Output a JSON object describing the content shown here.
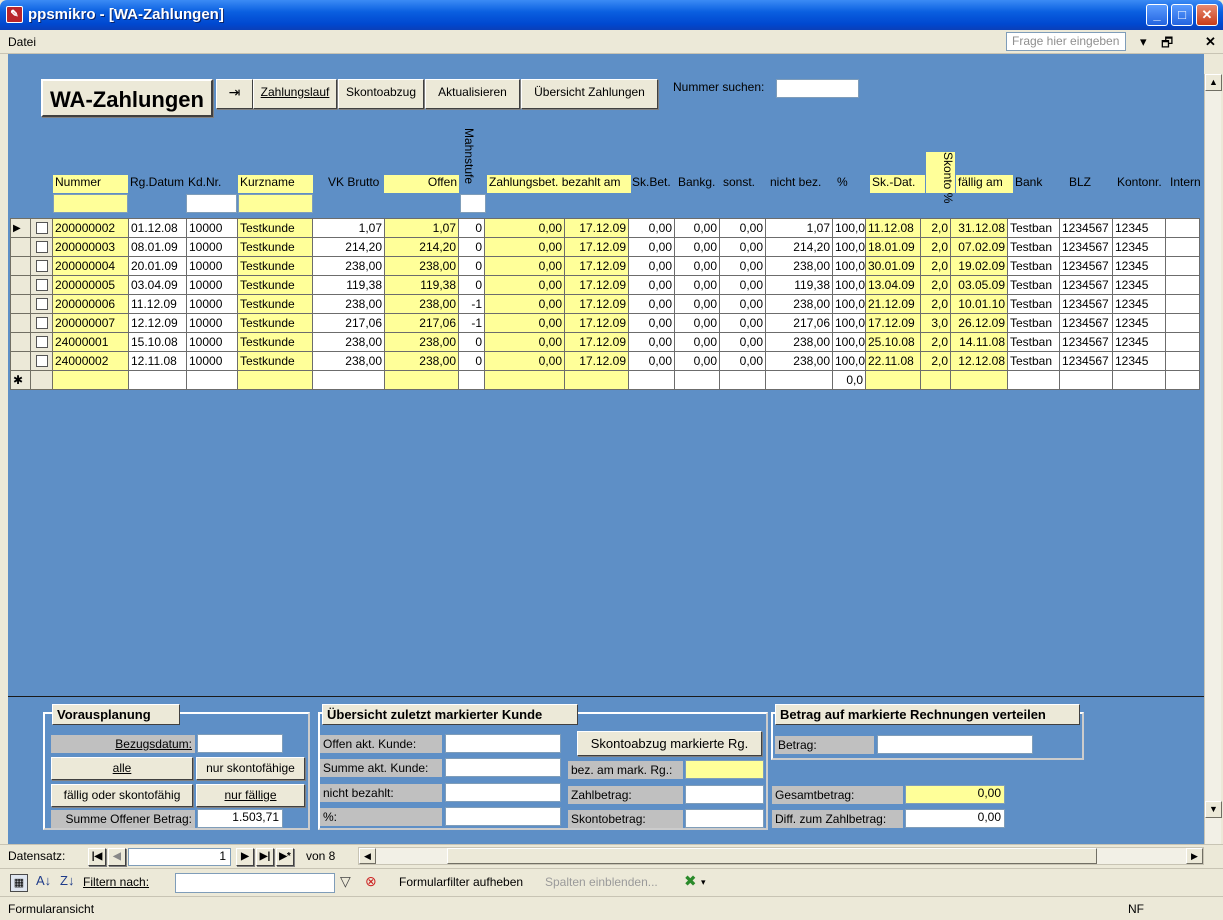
{
  "window": {
    "title": "ppsmikro - [WA-Zahlungen]"
  },
  "menu": {
    "datei": "Datei",
    "ask_placeholder": "Frage hier eingeben"
  },
  "toolbar": {
    "form_title": "WA-Zahlungen",
    "zahlungslauf": "Zahlungslauf",
    "skontoabzug": "Skontoabzug",
    "aktualisieren": "Aktualisieren",
    "uebersicht": "Übersicht Zahlungen",
    "nummer_suchen": "Nummer suchen:"
  },
  "columns": {
    "nummer": "Nummer",
    "rgdatum": "Rg.Datum",
    "kdnr": "Kd.Nr.",
    "kurzname": "Kurzname",
    "vkbrutto": "VK Brutto",
    "offen": "Offen",
    "mahnstufe": "Mahnstufe",
    "zahlungsbet": "Zahlungsbet.",
    "bezahltam": "bezahlt am",
    "skbet": "Sk.Bet.",
    "bankg": "Bankg.",
    "sonst": "sonst.",
    "nichtbez": "nicht bez.",
    "pct": "%",
    "skdat": "Sk.-Dat.",
    "skontopct": "Skonto %",
    "faelligam": "fällig am",
    "bank": "Bank",
    "blz": "BLZ",
    "kontonr": "Kontonr.",
    "intern": "Intern"
  },
  "rows": [
    [
      "200000002",
      "01.12.08",
      "10000",
      "Testkunde",
      "1,07",
      "1,07",
      "0",
      "0,00",
      "17.12.09",
      "0,00",
      "0,00",
      "0,00",
      "1,07",
      "100,0",
      "11.12.08",
      "2,0",
      "31.12.08",
      "Testban",
      "1234567",
      "12345"
    ],
    [
      "200000003",
      "08.01.09",
      "10000",
      "Testkunde",
      "214,20",
      "214,20",
      "0",
      "0,00",
      "17.12.09",
      "0,00",
      "0,00",
      "0,00",
      "214,20",
      "100,0",
      "18.01.09",
      "2,0",
      "07.02.09",
      "Testban",
      "1234567",
      "12345"
    ],
    [
      "200000004",
      "20.01.09",
      "10000",
      "Testkunde",
      "238,00",
      "238,00",
      "0",
      "0,00",
      "17.12.09",
      "0,00",
      "0,00",
      "0,00",
      "238,00",
      "100,0",
      "30.01.09",
      "2,0",
      "19.02.09",
      "Testban",
      "1234567",
      "12345"
    ],
    [
      "200000005",
      "03.04.09",
      "10000",
      "Testkunde",
      "119,38",
      "119,38",
      "0",
      "0,00",
      "17.12.09",
      "0,00",
      "0,00",
      "0,00",
      "119,38",
      "100,0",
      "13.04.09",
      "2,0",
      "03.05.09",
      "Testban",
      "1234567",
      "12345"
    ],
    [
      "200000006",
      "11.12.09",
      "10000",
      "Testkunde",
      "238,00",
      "238,00",
      "-1",
      "0,00",
      "17.12.09",
      "0,00",
      "0,00",
      "0,00",
      "238,00",
      "100,0",
      "21.12.09",
      "2,0",
      "10.01.10",
      "Testban",
      "1234567",
      "12345"
    ],
    [
      "200000007",
      "12.12.09",
      "10000",
      "Testkunde",
      "217,06",
      "217,06",
      "-1",
      "0,00",
      "17.12.09",
      "0,00",
      "0,00",
      "0,00",
      "217,06",
      "100,0",
      "17.12.09",
      "3,0",
      "26.12.09",
      "Testban",
      "1234567",
      "12345"
    ],
    [
      "24000001",
      "15.10.08",
      "10000",
      "Testkunde",
      "238,00",
      "238,00",
      "0",
      "0,00",
      "17.12.09",
      "0,00",
      "0,00",
      "0,00",
      "238,00",
      "100,0",
      "25.10.08",
      "2,0",
      "14.11.08",
      "Testban",
      "1234567",
      "12345"
    ],
    [
      "24000002",
      "12.11.08",
      "10000",
      "Testkunde",
      "238,00",
      "238,00",
      "0",
      "0,00",
      "17.12.09",
      "0,00",
      "0,00",
      "0,00",
      "238,00",
      "100,0",
      "22.11.08",
      "2,0",
      "12.12.08",
      "Testban",
      "1234567",
      "12345"
    ]
  ],
  "new_row_pct": "0,0",
  "vorausplanung": {
    "title": "Vorausplanung",
    "bezugsdatum": "Bezugsdatum:",
    "alle": "alle",
    "nur_skontofaehige": "nur skontofähige",
    "faellig_oder": "fällig oder skontofähig",
    "nur_faellige": "nur fällige",
    "summe_label": "Summe Offener Betrag:",
    "summe_value": "1.503,71"
  },
  "uebersicht": {
    "title": "Übersicht zuletzt markierter Kunde",
    "offen_akt": "Offen akt. Kunde:",
    "summe_akt": "Summe akt. Kunde:",
    "nicht_bezahlt": "nicht bezahlt:",
    "pct": "%:",
    "skonto_btn": "Skontoabzug markierte Rg.",
    "bez_am_mark": "bez. am mark. Rg.:",
    "zahlbetrag": "Zahlbetrag:",
    "skontobetrag": "Skontobetrag:"
  },
  "verteilen": {
    "title": "Betrag auf markierte Rechnungen verteilen",
    "betrag": "Betrag:",
    "gesamtbetrag": "Gesamtbetrag:",
    "gesamt_value": "0,00",
    "diff": "Diff. zum Zahlbetrag:",
    "diff_value": "0,00"
  },
  "nav": {
    "datensatz": "Datensatz:",
    "current": "1",
    "von": "von 8"
  },
  "filter": {
    "filtern_nach": "Filtern nach:",
    "formularfilter": "Formularfilter aufheben",
    "spalten": "Spalten einblenden..."
  },
  "status": {
    "left": "Formularansicht",
    "nf": "NF"
  },
  "colors": {
    "form_bg": "#5e8fc6",
    "highlight": "#ffff99",
    "title_blue": "#0a5fe0"
  }
}
